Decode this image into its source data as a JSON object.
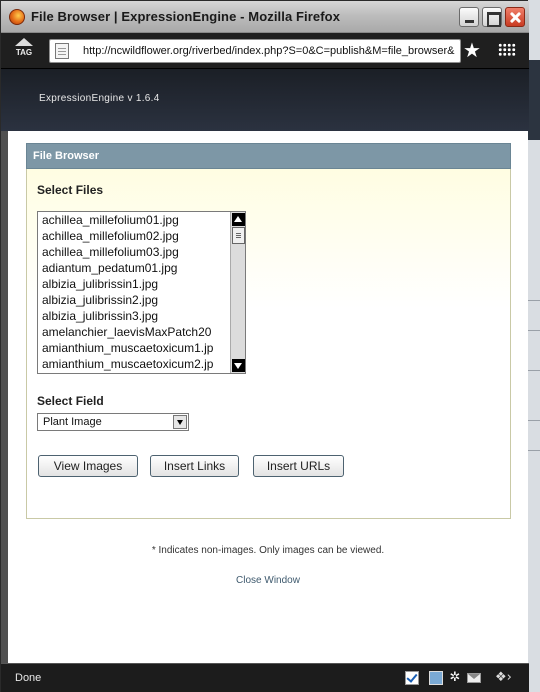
{
  "window": {
    "title": "File Browser | ExpressionEngine - Mozilla Firefox"
  },
  "navbar": {
    "tag_label": "TAG",
    "url": "http://ncwildflower.org/riverbed/index.php?S=0&C=publish&M=file_browser&"
  },
  "header": {
    "version": "ExpressionEngine  v 1.6.4"
  },
  "panel": {
    "title": "File Browser",
    "select_files_label": "Select Files",
    "files": [
      "achillea_millefolium01.jpg",
      "achillea_millefolium02.jpg",
      "achillea_millefolium03.jpg",
      "adiantum_pedatum01.jpg",
      "albizia_julibrissin1.jpg",
      "albizia_julibrissin2.jpg",
      "albizia_julibrissin3.jpg",
      "amelanchier_laevisMaxPatch20",
      "amianthium_muscaetoxicum1.jp",
      "amianthium_muscaetoxicum2.jp"
    ],
    "select_field_label": "Select Field",
    "selected_field": "Plant Image",
    "buttons": {
      "view_images": "View Images",
      "insert_links": "Insert Links",
      "insert_urls": "Insert URLs"
    }
  },
  "footer": {
    "note": "* Indicates non-images. Only images can be viewed.",
    "close_link": "Close Window"
  },
  "statusbar": {
    "status": "Done"
  },
  "colors": {
    "panel_header": "#7d97a6",
    "ee_header": "#1b1f26",
    "link": "#3f5a6e"
  }
}
